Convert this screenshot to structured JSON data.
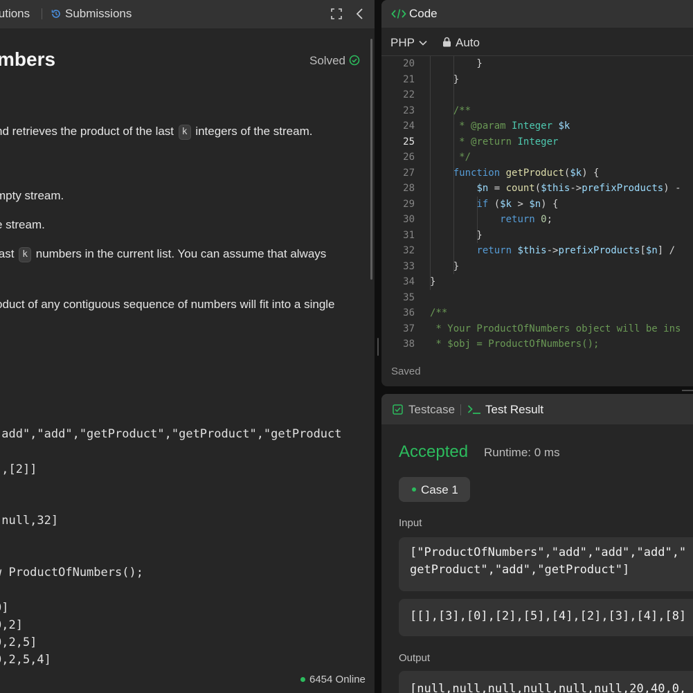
{
  "left_panel": {
    "tabs": {
      "solutions": "lutions",
      "submissions": "Submissions"
    },
    "problem_title": "mbers",
    "status": "Solved",
    "description": {
      "line1_pre": "nd retrieves the product of the last ",
      "line1_code": "k",
      "line1_post": " integers of the stream.",
      "line2": "mpty stream.",
      "line3": "e stream.",
      "line4_pre": " last ",
      "line4_code": "k",
      "line4_post": " numbers in the current list. You can assume that always",
      "line5": "oduct of any contiguous sequence of numbers will fit into a single"
    },
    "example": {
      "line1": "\"add\",\"add\",\"getProduct\",\"getProduct\",\"getProduct",
      "line2": "],[2]]",
      "line3": ",null,32]",
      "line4": "w ProductOfNumbers();",
      "line5": "0]",
      "line6": "0,2]",
      "line7": "0,2,5]",
      "line8": "0,2,5,4]"
    },
    "online_count": "6454 Online"
  },
  "code_panel": {
    "title": "Code",
    "language": "PHP",
    "mode": "Auto",
    "saved_label": "Saved",
    "active_line": 25,
    "lines": [
      {
        "n": "20",
        "text": "        }"
      },
      {
        "n": "21",
        "text": "    }"
      },
      {
        "n": "22",
        "text": ""
      },
      {
        "n": "23",
        "text": "    /**"
      },
      {
        "n": "24",
        "text": "     * @param Integer $k"
      },
      {
        "n": "25",
        "text": "     * @return Integer"
      },
      {
        "n": "26",
        "text": "     */"
      },
      {
        "n": "27",
        "text": "    function getProduct($k) {"
      },
      {
        "n": "28",
        "text": "        $n = count($this->prefixProducts) -"
      },
      {
        "n": "29",
        "text": "        if ($k > $n) {"
      },
      {
        "n": "30",
        "text": "            return 0;"
      },
      {
        "n": "31",
        "text": "        }"
      },
      {
        "n": "32",
        "text": "        return $this->prefixProducts[$n] /"
      },
      {
        "n": "33",
        "text": "    }"
      },
      {
        "n": "34",
        "text": "}"
      },
      {
        "n": "35",
        "text": ""
      },
      {
        "n": "36",
        "text": "/**"
      },
      {
        "n": "37",
        "text": " * Your ProductOfNumbers object will be ins"
      },
      {
        "n": "38",
        "text": " * $obj = ProductOfNumbers();"
      }
    ]
  },
  "result_panel": {
    "tabs": {
      "testcase": "Testcase",
      "test_result": "Test Result"
    },
    "verdict": "Accepted",
    "runtime": "Runtime: 0 ms",
    "case_label": "Case 1",
    "input_label": "Input",
    "input_line1": "[\"ProductOfNumbers\",\"add\",\"add\",\"add\",\"",
    "input_line2": "getProduct\",\"add\",\"getProduct\"]",
    "input_args": "[[],[3],[0],[2],[5],[4],[2],[3],[4],[8]",
    "output_label": "Output",
    "output_value": "[null,null,null,null,null,null,20,40,0,"
  },
  "colors": {
    "accent_green": "#2cbb5d",
    "panel_bg": "#262626",
    "header_bg": "#333333"
  }
}
